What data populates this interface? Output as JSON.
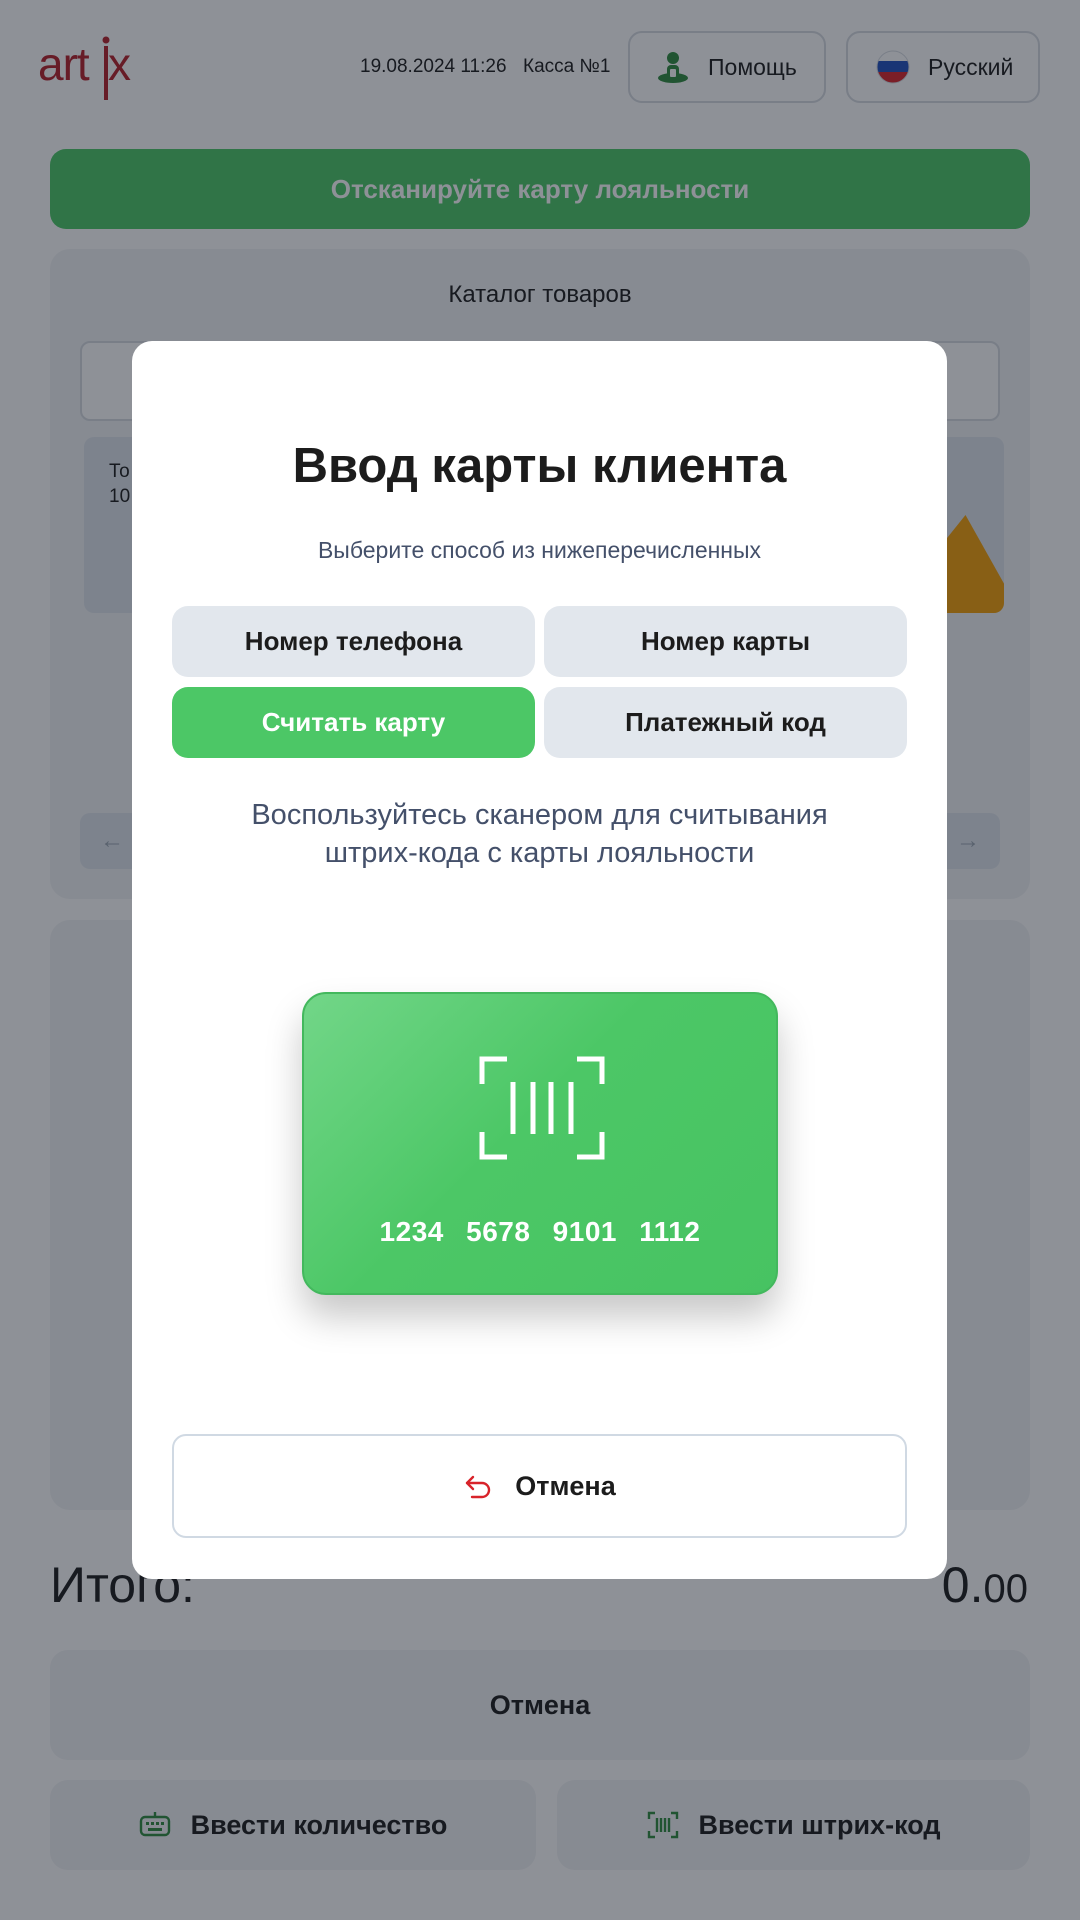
{
  "header": {
    "logo_text": "artix",
    "datetime": "19.08.2024 11:26",
    "register": "Касса №1",
    "help_label": "Помощь",
    "language_label": "Русский"
  },
  "banner": {
    "text": "Отсканируйте карту лояльности"
  },
  "catalog": {
    "title": "Каталог товаров",
    "search_placeholder": "",
    "product_partial_line1": "То",
    "product_partial_line2": "10"
  },
  "summary": {
    "total_label": "Итого:",
    "total_integer": "0.",
    "total_cents": "00"
  },
  "actions": {
    "cancel_label": "Отмена",
    "enter_quantity_label": "Ввести количество",
    "enter_barcode_label": "Ввести штрих-код"
  },
  "modal": {
    "title": "Ввод карты клиента",
    "subtitle": "Выберите способ из нижеперечисленных",
    "methods": [
      {
        "label": "Номер телефона",
        "active": false
      },
      {
        "label": "Номер карты",
        "active": false
      },
      {
        "label": "Считать карту",
        "active": true
      },
      {
        "label": "Платежный код",
        "active": false
      }
    ],
    "instruction_line1": "Воспользуйтесь сканером для считывания",
    "instruction_line2": "штрих-кода с карты лояльности",
    "card_number": "1234 5678 9101 1112",
    "cancel_label": "Отмена"
  },
  "colors": {
    "accent_green": "#4cc766",
    "brand_red": "#b5202a",
    "overlay": "rgba(19,25,38,0.48)"
  },
  "icons": {
    "help": "person-help-icon",
    "language": "russia-flag-icon",
    "cancel": "undo-arrow-icon",
    "quantity": "keyboard-icon",
    "barcode": "barcode-scan-icon"
  }
}
